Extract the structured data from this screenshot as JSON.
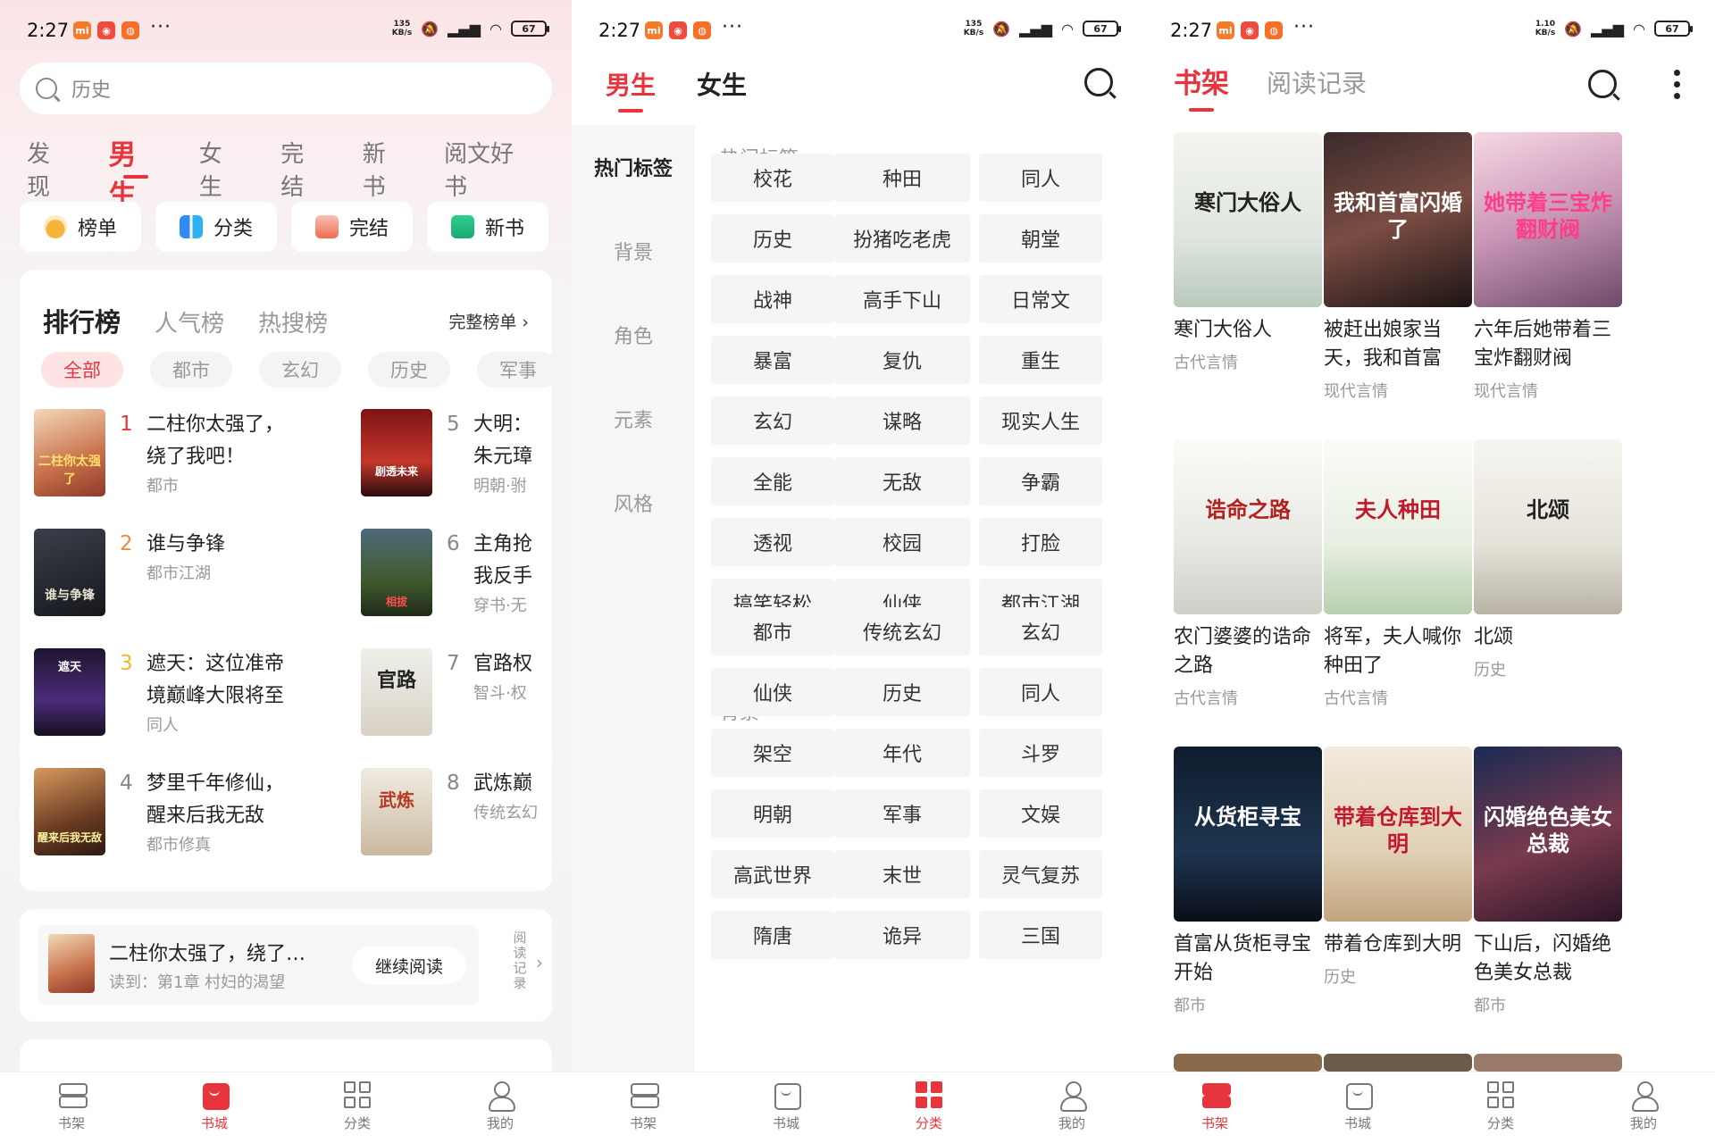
{
  "status": {
    "time": "2:27",
    "panels": [
      {
        "speed_top": "135",
        "speed_unit": "KB/s",
        "battery": "67"
      },
      {
        "speed_top": "135",
        "speed_unit": "KB/s",
        "battery": "67"
      },
      {
        "speed_top": "1.10",
        "speed_unit": "KB/s",
        "battery": "67"
      }
    ],
    "more": "···"
  },
  "store": {
    "search_placeholder": "历史",
    "tabs": [
      "发现",
      "男生",
      "女生",
      "完结",
      "新书",
      "阅文好书"
    ],
    "active_tab": "男生",
    "quick": [
      "榜单",
      "分类",
      "完结",
      "新书"
    ],
    "rank_tabs": [
      "排行榜",
      "人气榜",
      "热搜榜"
    ],
    "rank_more": "完整榜单",
    "chips": [
      "全部",
      "都市",
      "玄幻",
      "历史",
      "军事"
    ],
    "ranks": [
      {
        "n": "1",
        "title": "二柱你太强了，绕了我吧！",
        "sub": "都市"
      },
      {
        "n": "2",
        "title": "谁与争锋",
        "sub": "都市江湖"
      },
      {
        "n": "3",
        "title": "遮天：这位准帝境巅峰大限将至",
        "sub": "同人"
      },
      {
        "n": "4",
        "title": "梦里千年修仙，醒来后我无敌",
        "sub": "都市修真"
      },
      {
        "n": "5",
        "title": "大明：朱元璋",
        "sub": "明朝·驸"
      },
      {
        "n": "6",
        "title": "主角抢我反手",
        "sub": "穿书·无"
      },
      {
        "n": "7",
        "title": "官路权",
        "sub": "智斗·权"
      },
      {
        "n": "8",
        "title": "武炼巅",
        "sub": "传统玄幻"
      }
    ],
    "cover_texts": [
      "二柱你太强了",
      "剧透未来",
      "谁与争锋",
      "相拔",
      "遮天",
      "官路",
      "醒来后我无敌",
      "武炼"
    ],
    "continue": {
      "title": "二柱你太强了，绕了…",
      "progress": "读到：第1章 村妇的渴望",
      "button": "继续阅读",
      "history": "阅读记录"
    }
  },
  "category": {
    "tabs": [
      "男生",
      "女生"
    ],
    "active_tab": "男生",
    "side": [
      "热门标签",
      "背景",
      "角色",
      "元素",
      "风格"
    ],
    "hot_title": "热门标签",
    "hot_tags": [
      "校花",
      "种田",
      "同人",
      "历史",
      "扮猪吃老虎",
      "朝堂",
      "战神",
      "高手下山",
      "日常文",
      "暴富",
      "复仇",
      "重生",
      "玄幻",
      "谋略",
      "现实人生",
      "全能",
      "无敌",
      "争霸",
      "透视",
      "校园",
      "打脸",
      "搞笑轻松",
      "仙侠",
      "都市江湖"
    ],
    "bg_title": "背景",
    "bg_tags": [
      "都市",
      "传统玄幻",
      "玄幻",
      "仙侠",
      "历史",
      "同人",
      "架空",
      "年代",
      "斗罗",
      "明朝",
      "军事",
      "文娱",
      "高武世界",
      "末世",
      "灵气复苏",
      "隋唐",
      "诡异",
      "三国"
    ]
  },
  "shelf": {
    "tabs": [
      "书架",
      "阅读记录"
    ],
    "active_tab": "书架",
    "books": [
      {
        "title": "寒门大俗人",
        "cat": "古代言情",
        "cover": "寒门大俗人"
      },
      {
        "title": "被赶出娘家当天，我和首富",
        "cat": "现代言情",
        "cover": "我和首富闪婚了"
      },
      {
        "title": "六年后她带着三宝炸翻财阀",
        "cat": "现代言情",
        "cover": "她带着三宝炸翻财阀"
      },
      {
        "title": "农门婆婆的诰命之路",
        "cat": "古代言情",
        "cover": "诰命之路"
      },
      {
        "title": "将军，夫人喊你种田了",
        "cat": "古代言情",
        "cover": "夫人种田"
      },
      {
        "title": "北颂",
        "cat": "历史",
        "cover": "北颂"
      },
      {
        "title": "首富从货柜寻宝开始",
        "cat": "都市",
        "cover": "从货柜寻宝"
      },
      {
        "title": "带着仓库到大明",
        "cat": "历史",
        "cover": "带着仓库到大明"
      },
      {
        "title": "下山后，闪婚绝色美女总裁",
        "cat": "都市",
        "cover": "闪婚绝色美女总裁"
      }
    ]
  },
  "bottom_nav": {
    "labels": [
      "书架",
      "书城",
      "分类",
      "我的"
    ],
    "active": [
      "书城",
      "分类",
      "书架"
    ]
  },
  "colors": {
    "accent": "#e8343d",
    "muted": "#999999"
  }
}
